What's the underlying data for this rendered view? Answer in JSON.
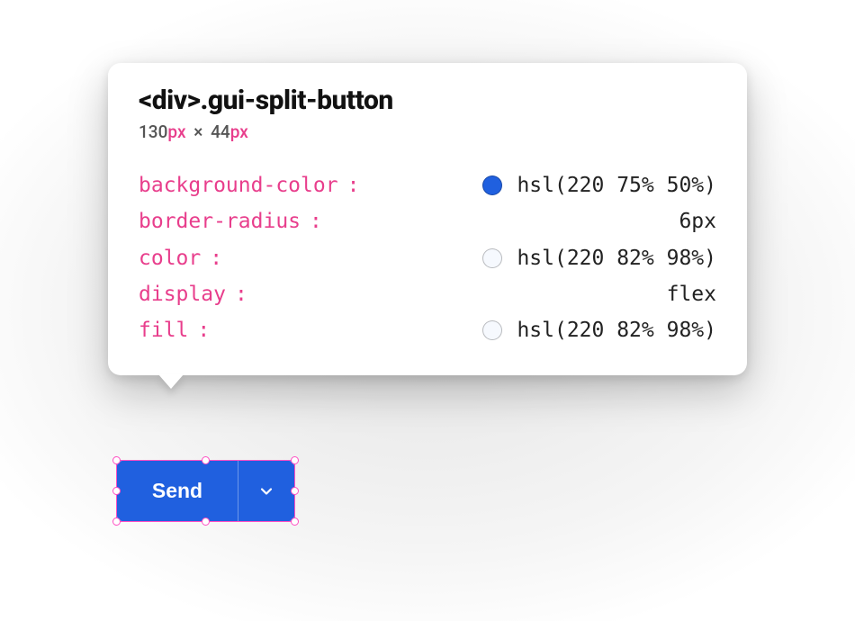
{
  "tooltip": {
    "selector": "<div>.gui-split-button",
    "width_value": "130",
    "width_unit": "px",
    "times": "×",
    "height_value": "44",
    "height_unit": "px",
    "props": [
      {
        "name": "background-color",
        "value": "hsl(220 75% 50%)",
        "swatch": "hsl(220 75% 50%)"
      },
      {
        "name": "border-radius",
        "value": "6px"
      },
      {
        "name": "color",
        "value": "hsl(220 82% 98%)",
        "swatch": "hsl(220 82% 98%)"
      },
      {
        "name": "display",
        "value": "flex"
      },
      {
        "name": "fill",
        "value": "hsl(220 82% 98%)",
        "swatch": "hsl(220 82% 98%)"
      }
    ]
  },
  "button": {
    "label": "Send"
  }
}
